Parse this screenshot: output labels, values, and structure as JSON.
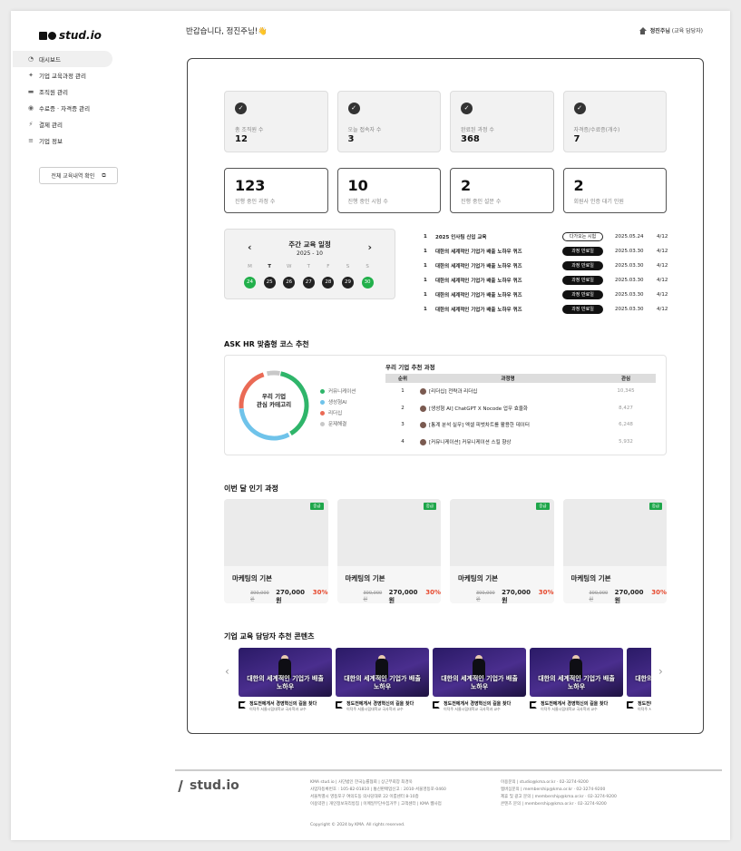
{
  "brand": {
    "logo_text": "stud.io",
    "footer_logo": "stud.io"
  },
  "header": {
    "greeting": "반갑습니다, 정진주님!👋",
    "user_name": "정진주님",
    "user_role": "(교육 담당자)"
  },
  "sidebar": {
    "items": [
      {
        "label": "대시보드",
        "icon": "dashboard-icon",
        "active": true
      },
      {
        "label": "기업 교육과정 관리",
        "icon": "course-icon"
      },
      {
        "label": "조직원 관리",
        "icon": "member-icon"
      },
      {
        "label": "수료증 · 자격증 관리",
        "icon": "certificate-icon"
      },
      {
        "label": "결제 관리",
        "icon": "payment-icon"
      },
      {
        "label": "기업 정보",
        "icon": "company-icon"
      }
    ],
    "history_button": "전체 교육내역 확인"
  },
  "stats_top": [
    {
      "label": "총 조직원 수",
      "value": "12"
    },
    {
      "label": "오늘 접속자 수",
      "value": "3"
    },
    {
      "label": "완료된 과정 수",
      "value": "368"
    },
    {
      "label": "자격증/수료증(개수)",
      "value": "7"
    }
  ],
  "stats_bottom": [
    {
      "value": "123",
      "label": "진행 중인 과정 수"
    },
    {
      "value": "10",
      "label": "진행 중인 시험 수"
    },
    {
      "value": "2",
      "label": "진행 중인 설문 수"
    },
    {
      "value": "2",
      "label": "회원사 인증 대기 인원"
    }
  ],
  "calendar": {
    "title": "주간 교육 일정",
    "subtitle": "2025 - 10",
    "days": [
      "M",
      "T",
      "W",
      "T",
      "F",
      "S",
      "S"
    ],
    "dates": [
      "24",
      "25",
      "26",
      "27",
      "28",
      "29",
      "30"
    ]
  },
  "schedule": [
    {
      "rank": "1",
      "title": "2025 인사팀 신입 교육",
      "badge": "다가오는 시험",
      "start": "2025.05.24",
      "end": "4/12"
    },
    {
      "rank": "1",
      "title": "대한의 세계적인 기업가 배출 노하우 퀴즈",
      "badge": "과정 만료일",
      "start": "2025.03.30",
      "end": "4/12"
    },
    {
      "rank": "1",
      "title": "대한의 세계적인 기업가 배출 노하우 퀴즈",
      "badge": "과정 만료일",
      "start": "2025.03.30",
      "end": "4/12"
    },
    {
      "rank": "1",
      "title": "대한의 세계적인 기업가 배출 노하우 퀴즈",
      "badge": "과정 만료일",
      "start": "2025.03.30",
      "end": "4/12"
    },
    {
      "rank": "1",
      "title": "대한의 세계적인 기업가 배출 노하우 퀴즈",
      "badge": "과정 만료일",
      "start": "2025.03.30",
      "end": "4/12"
    },
    {
      "rank": "1",
      "title": "대한의 세계적인 기업가 배출 노하우 퀴즈",
      "badge": "과정 만료일",
      "start": "2025.03.30",
      "end": "4/12"
    }
  ],
  "ask": {
    "title": "ASK HR 맞춤형 코스 추천",
    "donut_label_1": "우리 기업",
    "donut_label_2": "관심 카테고리",
    "legend": [
      {
        "label": "커뮤니케이션",
        "color": "#2fb56a"
      },
      {
        "label": "생성형AI",
        "color": "#6fc3ea"
      },
      {
        "label": "리더십",
        "color": "#ea6a55"
      },
      {
        "label": "문제해결",
        "color": "#c8c8c8"
      }
    ],
    "table_title": "우리 기업 추천 과정",
    "columns": [
      "순위",
      "과정명",
      "관심"
    ],
    "rows": [
      {
        "rank": "1",
        "name": "[리더십] 전략과 리더십",
        "views": "10,345"
      },
      {
        "rank": "2",
        "name": "[생성형 AI] ChatGPT X Nocode 업무 효율화",
        "views": "8,427"
      },
      {
        "rank": "3",
        "name": "[통계 분석 실무] 엑셀 피벗차트를 활용한 데이터",
        "views": "6,248"
      },
      {
        "rank": "4",
        "name": "[커뮤니케이션] 커뮤니케이션 스킬 향상",
        "views": "5,932"
      }
    ]
  },
  "popular": {
    "title": "이번 달 인기 과정",
    "cards": [
      {
        "tag": "중급",
        "title": "마케팅의 기본",
        "old_price": "300,000원",
        "price": "270,000원",
        "discount": "30%"
      },
      {
        "tag": "중급",
        "title": "마케팅의 기본",
        "old_price": "300,000원",
        "price": "270,000원",
        "discount": "30%"
      },
      {
        "tag": "중급",
        "title": "마케팅의 기본",
        "old_price": "300,000원",
        "price": "270,000원",
        "discount": "30%"
      },
      {
        "tag": "중급",
        "title": "마케팅의 기본",
        "old_price": "300,000원",
        "price": "270,000원",
        "discount": "30%"
      }
    ]
  },
  "recommend": {
    "title": "기업 교육 담당자 추천 콘텐츠",
    "videos": [
      {
        "thumb_title": "대한의 세계적인 기업가 배출 노하우",
        "title": "정도전에게서 경영혁신의 길을 찾다",
        "desc": "이덕주 서울시립대학교 국사학과 교수"
      },
      {
        "thumb_title": "대한의 세계적인 기업가 배출 노하우",
        "title": "정도전에게서 경영혁신의 길을 찾다",
        "desc": "이덕주 서울시립대학교 국사학과 교수"
      },
      {
        "thumb_title": "대한의 세계적인 기업가 배출 노하우",
        "title": "정도전에게서 경영혁신의 길을 찾다",
        "desc": "이덕주 서울시립대학교 국사학과 교수"
      },
      {
        "thumb_title": "대한의 세계적인 기업가 배출 노하우",
        "title": "정도전에게서 경영혁신의 길을 찾다",
        "desc": "이덕주 서울시립대학교 국사학과 교수"
      },
      {
        "thumb_title": "대한의 세계적인 기업가 배출 노하우",
        "title": "정도전에게서 경영혁신의 길을 찾다",
        "desc": "이덕주 서울시립대학교 국사학과 교수"
      }
    ]
  },
  "footer": {
    "col1": [
      "KMA stud.io | 사단법인 한국능률협회 | 상근부회장 최경욱",
      "사업자등록번호 : 105-82-01810 | 통신판매업신고 : 2010-서울영등포-0460",
      "서울특별시 영등포구 여의도동 의사당대로 22 이룸센터 8-10층",
      "이용약관 | 개인정보처리방침 | 이메일무단수집거부 | 고객센터 | KMA 웹사업"
    ],
    "col2": [
      "이용문의 | studio@kma.or.kr · 02-3274-9200",
      "멤버십문의 | membership@kma.or.kr · 02-3274-9200",
      "제휴 및 광고 문의 | membership@kma.or.kr · 02-3274-9200",
      "콘텐츠 문의 | membership@kma.or.kr · 02-3274-9200"
    ],
    "copyright": "Copyright © 2024 by KMA. All rights reserved."
  }
}
